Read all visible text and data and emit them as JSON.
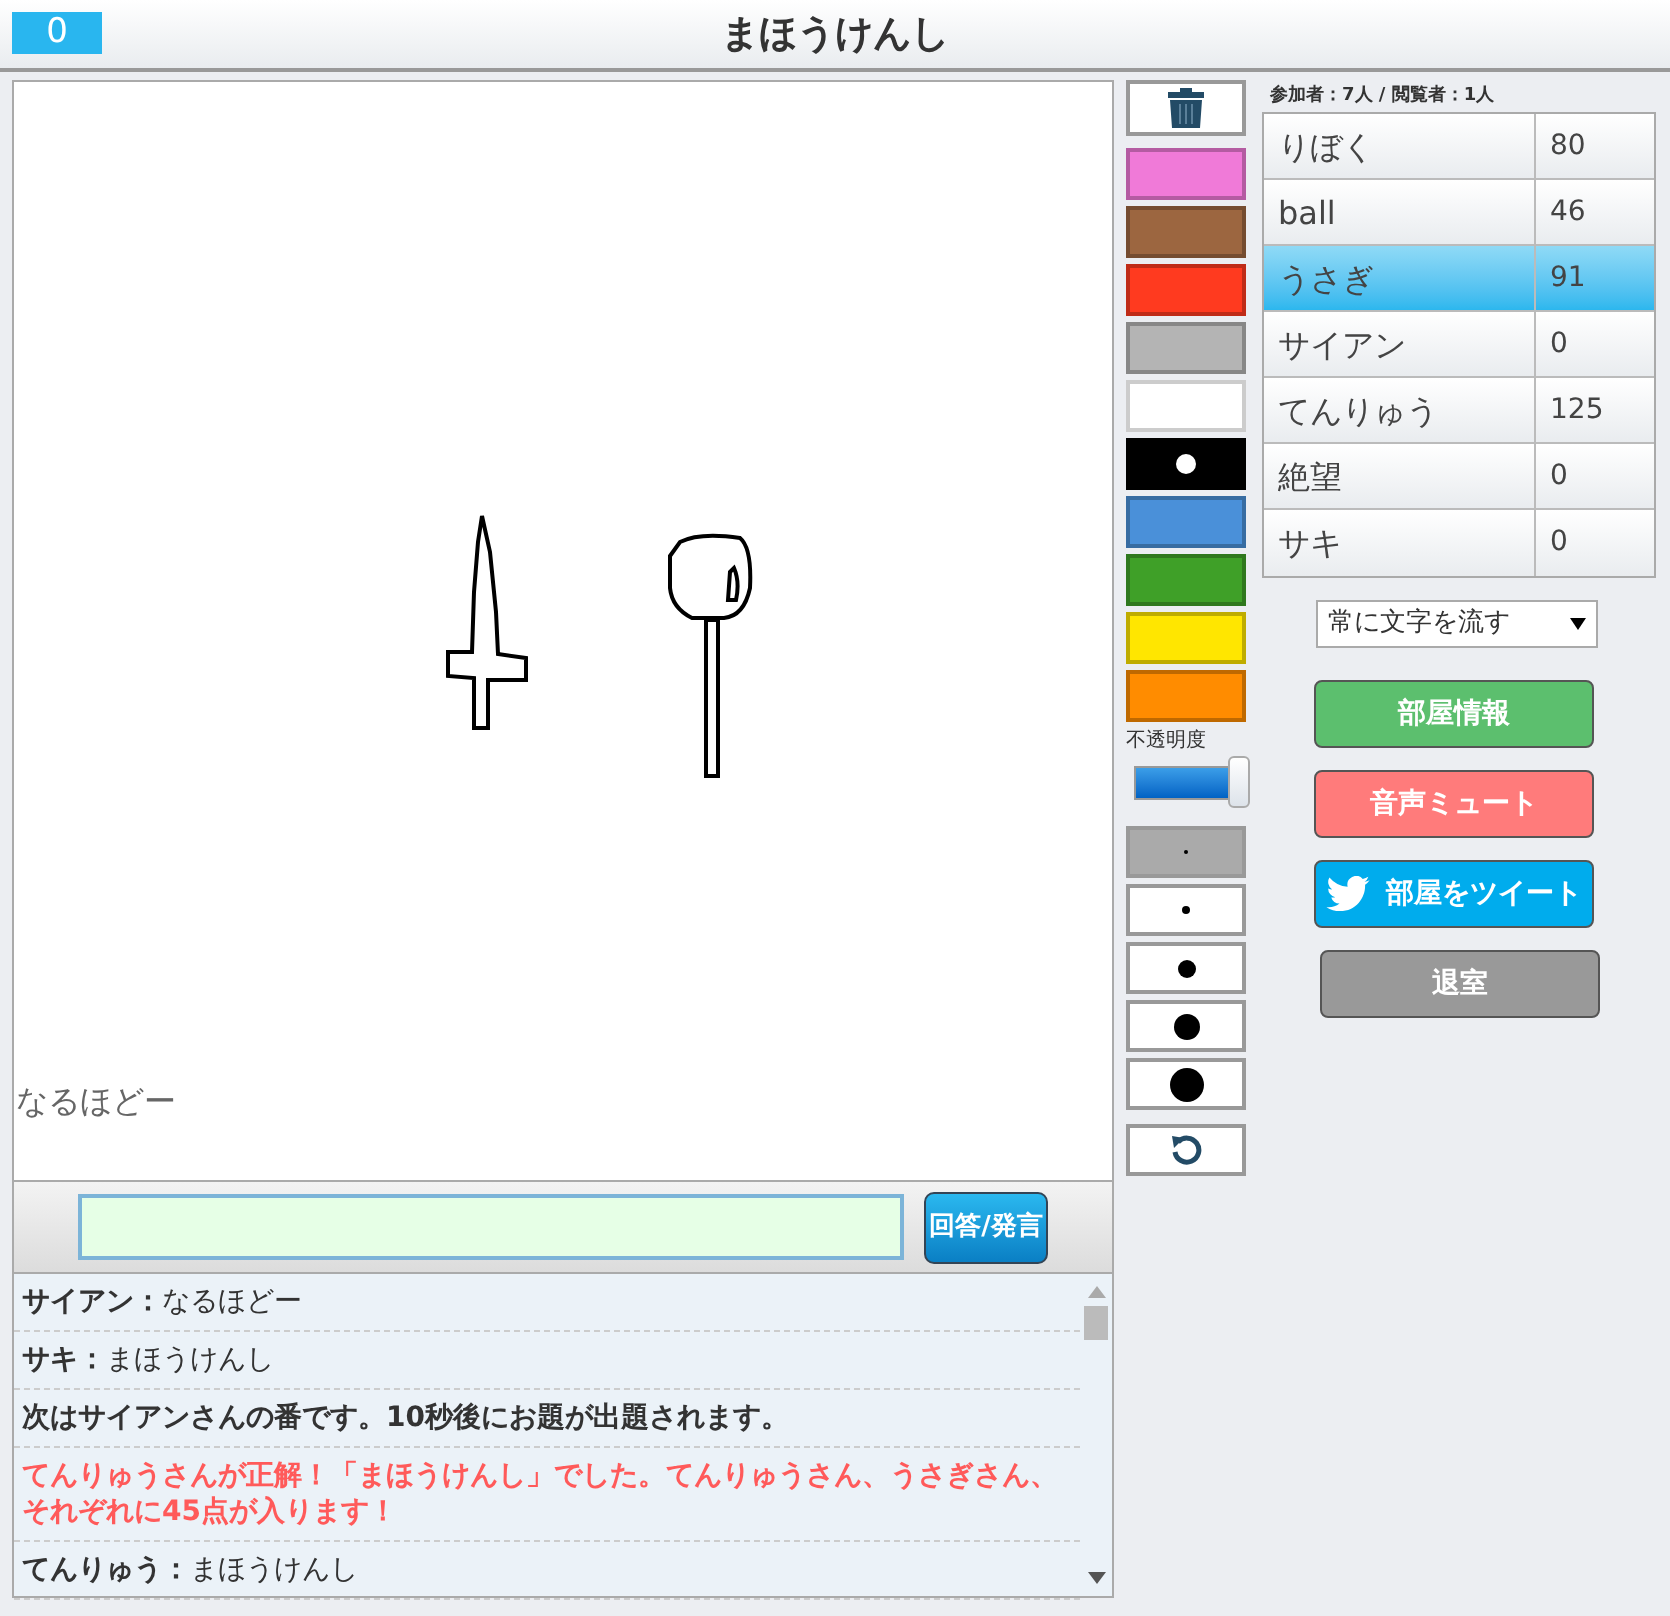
{
  "header": {
    "score": "0",
    "title": "まほうけんし"
  },
  "canvas": {
    "floating_text": "なるほどー"
  },
  "answer": {
    "button": "回答/発言"
  },
  "chat": [
    {
      "kind": "user",
      "speaker": "サイアン：",
      "text": "なるほどー"
    },
    {
      "kind": "user",
      "speaker": "サキ：",
      "text": "まほうけんし"
    },
    {
      "kind": "system",
      "text": "次はサイアンさんの番です。10秒後にお題が出題されます。"
    },
    {
      "kind": "notice",
      "text": "てんりゅうさんが正解！「まほうけんし」でした。てんりゅうさん、うさぎさん、それぞれに45点が入ります！"
    },
    {
      "kind": "user",
      "speaker": "てんりゅう：",
      "text": "まほうけんし"
    }
  ],
  "palette": [
    {
      "color": "#f07ad8",
      "selected": false
    },
    {
      "color": "#9c6640",
      "selected": false
    },
    {
      "color": "#ff3a1f",
      "selected": false
    },
    {
      "color": "#b4b4b4",
      "selected": false
    },
    {
      "color": "#ffffff",
      "selected": false
    },
    {
      "color": "#000000",
      "selected": true
    },
    {
      "color": "#4a90d9",
      "selected": false
    },
    {
      "color": "#3fa028",
      "selected": false
    },
    {
      "color": "#ffe600",
      "selected": false
    },
    {
      "color": "#ff8c00",
      "selected": false
    }
  ],
  "opacity": {
    "label": "不透明度",
    "level": 1
  },
  "brush_sizes": [
    {
      "selected": true
    },
    {
      "selected": false
    },
    {
      "selected": false
    },
    {
      "selected": false
    },
    {
      "selected": false
    }
  ],
  "participants": "参加者：7人 / 閲覧者：1人",
  "players": [
    {
      "name": "りぼく",
      "score": "80",
      "selected": false
    },
    {
      "name": "ball",
      "score": "46",
      "selected": false
    },
    {
      "name": "うさぎ",
      "score": "91",
      "selected": true
    },
    {
      "name": "サイアン",
      "score": "0",
      "selected": false
    },
    {
      "name": "てんりゅう",
      "score": "125",
      "selected": false
    },
    {
      "name": "絶望",
      "score": "0",
      "selected": false
    },
    {
      "name": "サキ",
      "score": "0",
      "selected": false
    }
  ],
  "text_mode": "常に文字を流す",
  "buttons": [
    {
      "kind": "info",
      "label": "部屋情報"
    },
    {
      "kind": "mute",
      "label": "音声ミュート"
    },
    {
      "kind": "tweet",
      "label": "部屋をツイート"
    },
    {
      "kind": "exit",
      "label": "退室"
    }
  ]
}
